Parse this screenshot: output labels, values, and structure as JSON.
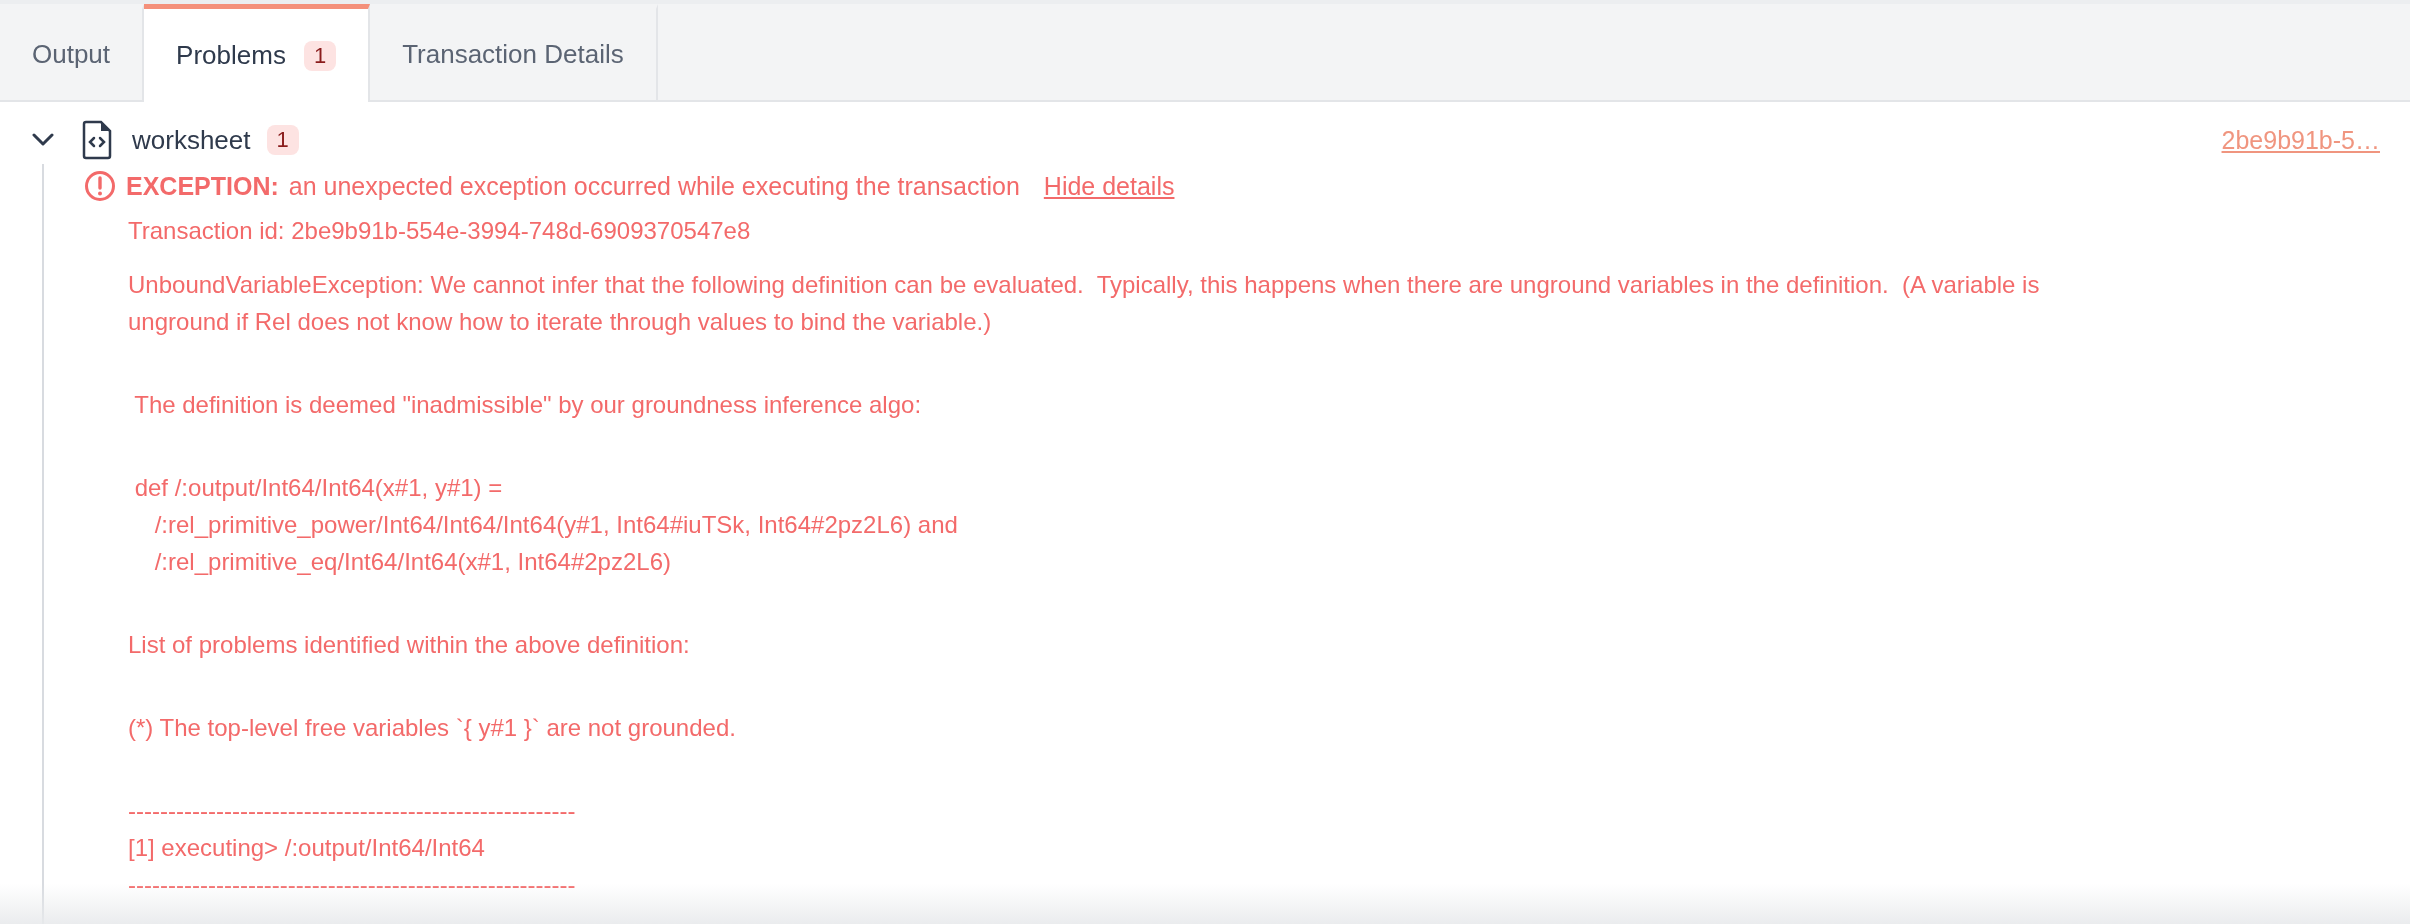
{
  "tabs": [
    {
      "label": "Output",
      "selected": false
    },
    {
      "label": "Problems",
      "selected": true,
      "badge": "1"
    },
    {
      "label": "Transaction Details",
      "selected": false
    }
  ],
  "problems": [
    {
      "file": "worksheet",
      "badge": "1",
      "expanded": true,
      "transaction_link": "2be9b91b-5…",
      "items": [
        {
          "severity_label": "EXCEPTION:",
          "message": "an unexpected exception occurred while executing the transaction",
          "toggle": "Hide details",
          "transaction_id": "Transaction id: 2be9b91b-554e-3994-748d-6909370547e8",
          "details": [
            [
              "UnboundVariableException: We cannot infer that the following definition can be evaluated.  Typically, this happens when there are unground variables in the definition.  (A variable is",
              "unground if Rel does not know how to iterate through values to bind the variable.)"
            ],
            [
              " The definition is deemed \"inadmissible\" by our groundness inference algo:"
            ],
            [
              " def /:output/Int64/Int64(x#1, y#1) =",
              "    /:rel_primitive_power/Int64/Int64/Int64(y#1, Int64#iuTSk, Int64#2pz2L6) and",
              "    /:rel_primitive_eq/Int64/Int64(x#1, Int64#2pz2L6)"
            ],
            [
              "List of problems identified within the above definition:"
            ],
            [
              "(*) The top-level free variables `{ y#1 }` are not grounded."
            ],
            [
              "--------------------------------------------------------",
              "[1] executing> /:output/Int64/Int64",
              "--------------------------------------------------------"
            ]
          ]
        }
      ]
    }
  ]
}
